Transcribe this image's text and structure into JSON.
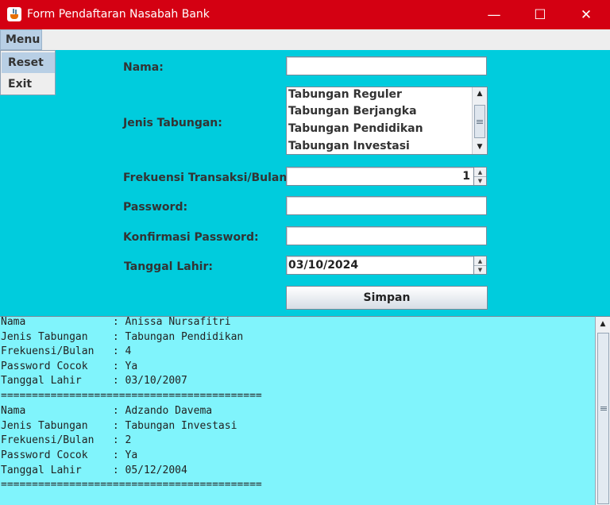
{
  "window": {
    "title": "Form Pendaftaran Nasabah Bank",
    "minimize_glyph": "—",
    "maximize_glyph": "☐",
    "close_glyph": "✕"
  },
  "menu": {
    "label": "Menu",
    "items": [
      {
        "label": "Reset"
      },
      {
        "label": "Exit"
      }
    ]
  },
  "form": {
    "nama": {
      "label": "Nama:",
      "value": ""
    },
    "jenis_tabungan": {
      "label": "Jenis Tabungan:",
      "options": [
        "Tabungan Reguler",
        "Tabungan Berjangka",
        "Tabungan Pendidikan",
        "Tabungan Investasi"
      ]
    },
    "frekuensi": {
      "label": "Frekuensi Transaksi/Bulan:",
      "value": "1"
    },
    "password": {
      "label": "Password:",
      "value": ""
    },
    "konfirmasi": {
      "label": "Konfirmasi Password:",
      "value": ""
    },
    "tanggal_lahir": {
      "label": "Tanggal Lahir:",
      "value": "03/10/2024"
    },
    "submit_label": "Simpan"
  },
  "output": {
    "lines": [
      "Nama              : Anissa Nursafitri",
      "Jenis Tabungan    : Tabungan Pendidikan",
      "Frekuensi/Bulan   : 4",
      "Password Cocok    : Ya",
      "Tanggal Lahir     : 03/10/2007",
      "==========================================",
      "Nama              : Adzando Davema",
      "Jenis Tabungan    : Tabungan Investasi",
      "Frekuensi/Bulan   : 2",
      "Password Cocok    : Ya",
      "Tanggal Lahir     : 05/12/2004",
      "=========================================="
    ]
  },
  "colors": {
    "titlebar": "#D40012",
    "form_background": "#00CCDD",
    "output_background": "#80F4FC",
    "menu_highlight": "#B8CFE5"
  }
}
